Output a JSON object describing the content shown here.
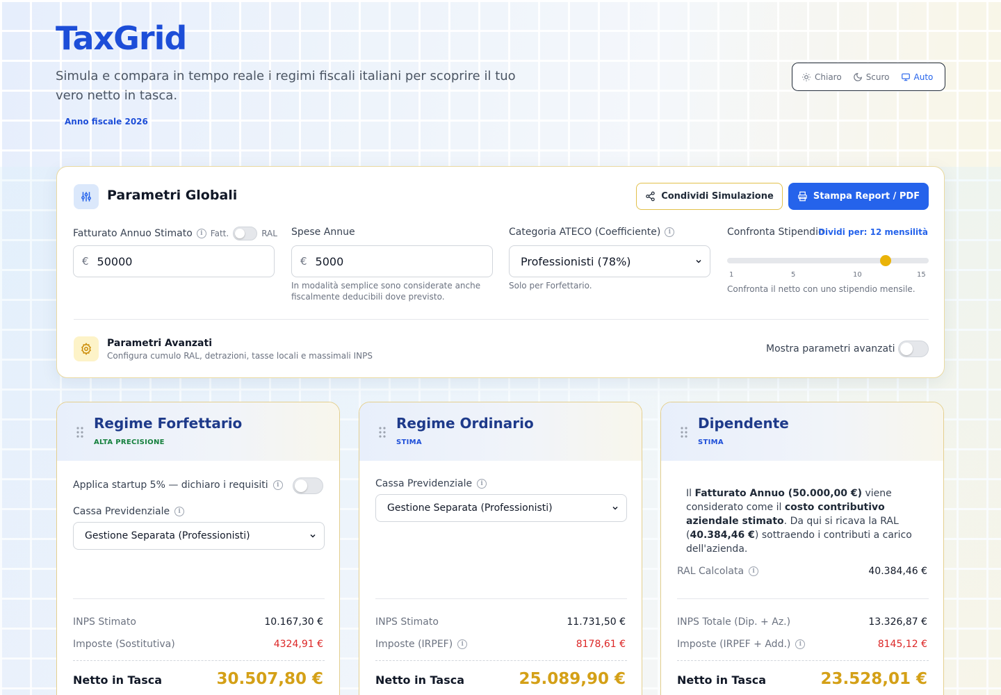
{
  "app": {
    "logo": "TaxGrid",
    "subtitle": "Simula e compara in tempo reale i regimi fiscali italiani per scoprire il tuo vero netto in tasca.",
    "fiscal_year": "Anno fiscale 2026"
  },
  "theme": {
    "options": [
      {
        "label": "Chiaro",
        "icon": "sun-icon"
      },
      {
        "label": "Scuro",
        "icon": "moon-icon"
      },
      {
        "label": "Auto",
        "icon": "monitor-icon"
      }
    ],
    "selected": "Auto"
  },
  "global": {
    "title": "Parametri Globali",
    "share_label": "Condividi Simulazione",
    "print_label": "Stampa Report / PDF",
    "revenue": {
      "label": "Fatturato Annuo Stimato",
      "toggle_left": "Fatt.",
      "toggle_right": "RAL",
      "currency": "€",
      "value": "50000"
    },
    "expenses": {
      "label": "Spese Annue",
      "currency": "€",
      "value": "5000",
      "hint": "In modalità semplice sono considerate anche fiscalmente deducibili dove previsto."
    },
    "ateco": {
      "label": "Categoria ATECO (Coefficiente)",
      "selected": "Professionisti (78%)",
      "hint": "Solo per Forfettario."
    },
    "salary": {
      "label": "Confronta Stipendio",
      "divide_label": "Dividi per: 12 mensilità",
      "slider_value": 12,
      "slider_min": 1,
      "slider_max": 15,
      "ticks": [
        "1",
        "5",
        "10",
        "15"
      ],
      "hint": "Confronta il netto con uno stipendio mensile."
    },
    "advanced": {
      "title": "Parametri Avanzati",
      "subtitle": "Configura cumulo RAL, detrazioni, tasse locali e massimali INPS",
      "toggle_label": "Mostra parametri avanzati"
    }
  },
  "regimes": [
    {
      "title": "Regime Forfettario",
      "badge": "ALTA PRECISIONE",
      "badge_color": "#15803d",
      "startup_label": "Applica startup 5% — dichiaro i requisiti",
      "cassa_label": "Cassa Previdenziale",
      "cassa_selected": "Gestione Separata (Professionisti)",
      "inps_label": "INPS Stimato",
      "inps_value": "10.167,30 €",
      "tax_label": "Imposte (Sostitutiva)",
      "tax_value": "4324,91 €",
      "net_label": "Netto in Tasca",
      "net_value": "30.507,80 €"
    },
    {
      "title": "Regime Ordinario",
      "badge": "STIMA",
      "badge_color": "#1d4ed8",
      "cassa_label": "Cassa Previdenziale",
      "cassa_selected": "Gestione Separata (Professionisti)",
      "inps_label": "INPS Stimato",
      "inps_value": "11.731,50 €",
      "tax_label": "Imposte (IRPEF)",
      "tax_value": "8178,61 €",
      "net_label": "Netto in Tasca",
      "net_value": "25.089,90 €"
    },
    {
      "title": "Dipendente",
      "badge": "STIMA",
      "badge_color": "#1d4ed8",
      "desc_1": "Il ",
      "desc_b1": "Fatturato Annuo (50.000,00 €)",
      "desc_2": " viene considerato come il ",
      "desc_b2": "costo contributivo aziendale stimato",
      "desc_3": ". Da qui si ricava la RAL (",
      "desc_b3": "40.384,46 €",
      "desc_4": ") sottraendo i contributi a carico dell'azienda.",
      "ral_label": "RAL Calcolata",
      "ral_value": "40.384,46 €",
      "inps_label": "INPS Totale (Dip. + Az.)",
      "inps_value": "13.326,87 €",
      "tax_label": "Imposte (IRPEF + Add.)",
      "tax_value": "8145,12 €",
      "net_label": "Netto in Tasca",
      "net_value": "23.528,01 €"
    }
  ]
}
